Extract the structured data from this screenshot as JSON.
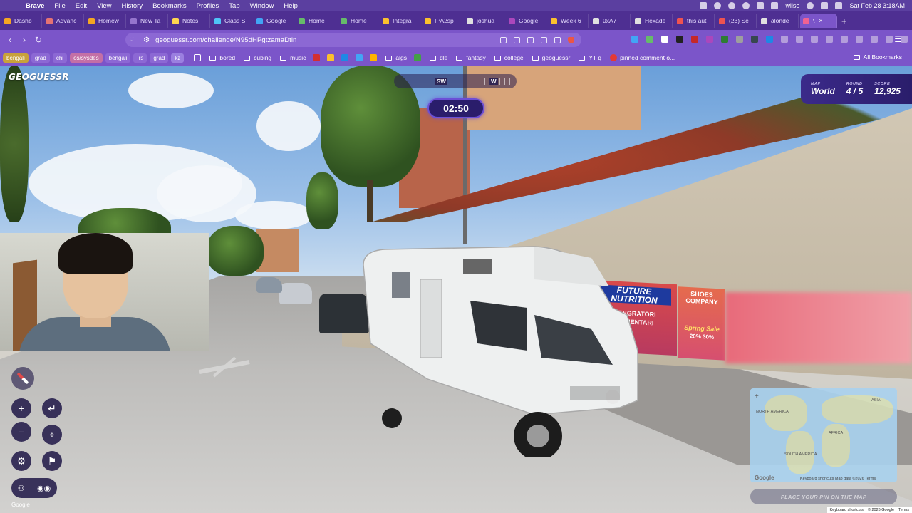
{
  "menubar": {
    "app_name": "Brave",
    "items": [
      "File",
      "Edit",
      "View",
      "History",
      "Bookmarks",
      "Profiles",
      "Tab",
      "Window",
      "Help"
    ],
    "user": "wilso",
    "datetime": "Sat Feb 28  3:18AM"
  },
  "tabs": [
    {
      "label": "Dashb",
      "color": "#f5a623"
    },
    {
      "label": "Advanc",
      "color": "#e57373"
    },
    {
      "label": "Homew",
      "color": "#f5a623"
    },
    {
      "label": "New Ta",
      "color": "#9575cd"
    },
    {
      "label": "Notes",
      "color": "#ffd54f"
    },
    {
      "label": "Class S",
      "color": "#4fc3f7"
    },
    {
      "label": "Google",
      "color": "#42a5f5"
    },
    {
      "label": "Home",
      "color": "#66bb6a"
    },
    {
      "label": "Home",
      "color": "#66bb6a"
    },
    {
      "label": "Integra",
      "color": "#fbc02d"
    },
    {
      "label": "IPA2sp",
      "color": "#fbc02d"
    },
    {
      "label": "joshua",
      "color": "#e0e0e0"
    },
    {
      "label": "Google",
      "color": "#ab47bc"
    },
    {
      "label": "Week 6",
      "color": "#fbc02d"
    },
    {
      "label": "0xA7",
      "color": "#e0e0e0"
    },
    {
      "label": "Hexade",
      "color": "#e0e0e0"
    },
    {
      "label": "this aut",
      "color": "#ef5350"
    },
    {
      "label": "(23) Se",
      "color": "#ef5350"
    },
    {
      "label": "alonde",
      "color": "#e0e0e0"
    },
    {
      "label": "\\",
      "color": "#f06292",
      "active": true
    }
  ],
  "addressbar": {
    "url": "geoguessr.com/challenge/N95dHPgtzamaDtln"
  },
  "bookmarks": {
    "pills": [
      {
        "label": "bengali",
        "bg": "#c8a13a"
      },
      {
        "label": "grad",
        "bg": "#8c68d4"
      },
      {
        "label": "chi",
        "bg": "#8c68d4"
      },
      {
        "label": "os/sysdes",
        "bg": "#c46fa6"
      },
      {
        "label": "bengali",
        "bg": "#8c68d4"
      },
      {
        "label": ".rs",
        "bg": "#8c68d4"
      },
      {
        "label": "grad",
        "bg": "#8c68d4"
      },
      {
        "label": "kz",
        "bg": "#9b7fe0"
      }
    ],
    "folders_a": [
      "bored",
      "cubing",
      "music"
    ],
    "folders_b": [
      "algs"
    ],
    "folders_c": [
      "dle",
      "fantasy",
      "college",
      "geoguessr",
      "YT q"
    ],
    "pinned": "pinned comment o...",
    "all_bookmarks": "All Bookmarks"
  },
  "game": {
    "logo": "GEOGUESSR",
    "compass_left": "SW",
    "compass_right": "W",
    "timer": "02:50",
    "map_label": "MAP",
    "map_value": "World",
    "round_label": "ROUND",
    "round_value": "4 / 5",
    "score_label": "SCORE",
    "score_value": "12,925",
    "place_pin": "PLACE YOUR PIN ON THE MAP",
    "google_watermark": "Google"
  },
  "scene_text": {
    "billboard_line1": "FUTURE",
    "billboard_line2": "NUTRITION",
    "billboard_line3": "INTEGRATORI",
    "billboard_line4": "ALIMENTARI",
    "shoes_line1": "SHOES",
    "shoes_line2": "COMPANY",
    "spring": "Spring Sale",
    "pct1": "20%",
    "pct2": "30%"
  },
  "minimap": {
    "labels": [
      "AFRICA",
      "SOUTH AMERICA",
      "NORTH AMERICA",
      "ASIA"
    ],
    "footer": "Keyboard shortcuts   Map data ©2026   Terms",
    "google": "Google"
  },
  "footer": {
    "shortcuts": "Keyboard shortcuts",
    "mapdata": "© 2026 Google",
    "terms": "Terms"
  }
}
